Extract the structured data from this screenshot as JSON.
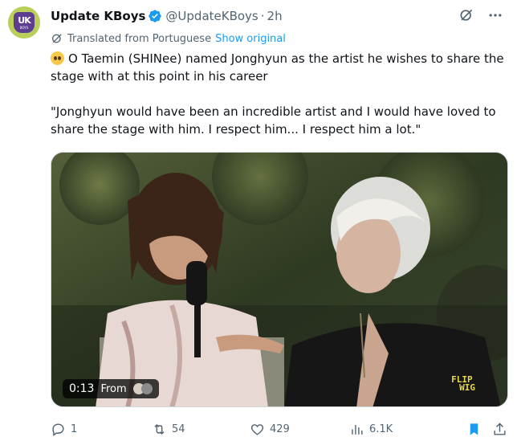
{
  "author": {
    "name": "Update KBoys",
    "handle": "@UpdateKBoys",
    "separator": "·",
    "time": "2h",
    "avatar_text": "UK",
    "avatar_subtext": "BOYS",
    "verified": true
  },
  "translation": {
    "label": "Translated from Portuguese",
    "show_original": "Show original"
  },
  "tweet": {
    "line1": "O Taemin (SHINee) named Jonghyun as the artist he wishes to share the stage with at this point in his career",
    "line2": "\"Jonghyun would have been an incredible artist and I would have loved to share the stage with him. I respect him... I respect him a lot.\"",
    "emoji": "pleading-face-emoji"
  },
  "media": {
    "timecode": "0:13",
    "from_label": "From",
    "watermark_line1": "FLIP",
    "watermark_line2": "WIG"
  },
  "actions": {
    "replies": "1",
    "retweets": "54",
    "likes": "429",
    "views": "6.1K"
  },
  "colors": {
    "accent": "#1d9bf0",
    "secondary_text": "#536471",
    "verified": "#1d9bf0"
  }
}
